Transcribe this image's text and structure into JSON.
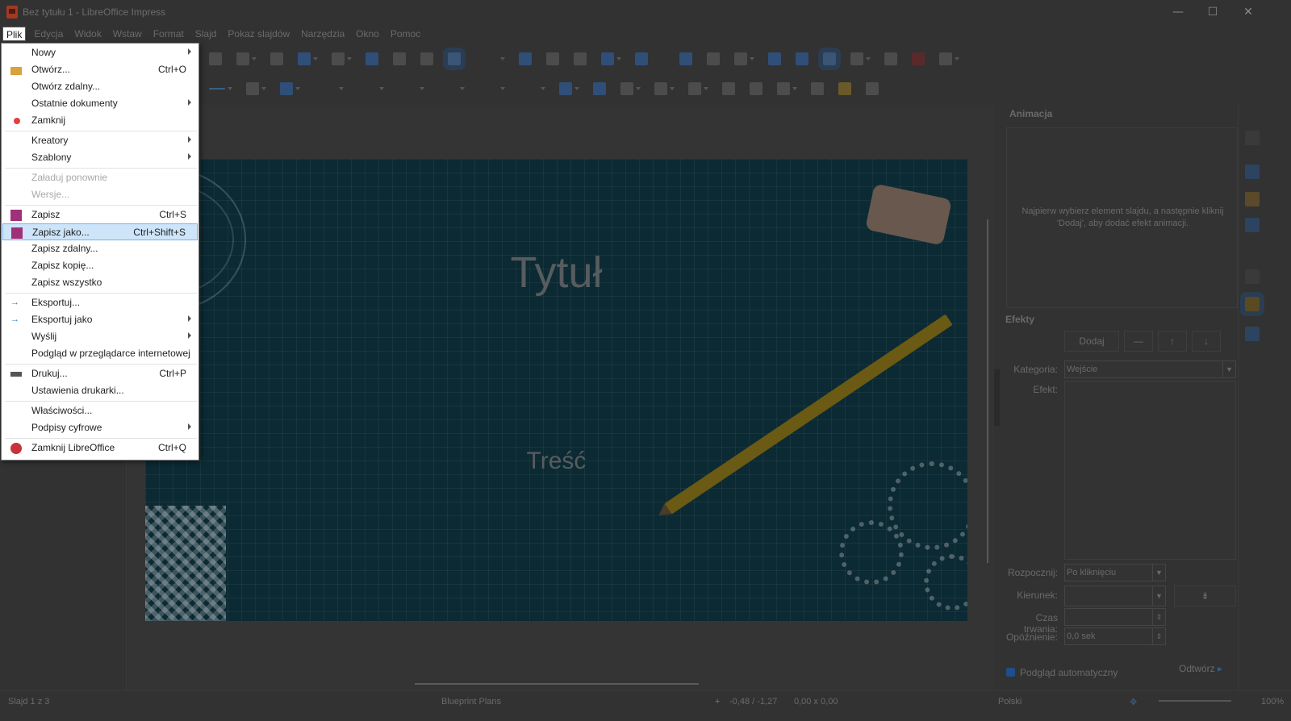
{
  "window": {
    "title": "Bez tytułu 1 - LibreOffice Impress",
    "minimize": "—",
    "maximize": "☐",
    "close": "✕"
  },
  "menubar": [
    "Plik",
    "Edycja",
    "Widok",
    "Wstaw",
    "Format",
    "Slajd",
    "Pokaz slajdów",
    "Narzędzia",
    "Okno",
    "Pomoc"
  ],
  "file_menu": {
    "items": [
      {
        "label": "Nowy",
        "submenu": true
      },
      {
        "label": "Otwórz...",
        "shortcut": "Ctrl+O",
        "icon": "folder-open-icon"
      },
      {
        "label": "Otwórz zdalny..."
      },
      {
        "label": "Ostatnie dokumenty",
        "submenu": true
      },
      {
        "label": "Zamknij",
        "icon": "close-document-icon"
      },
      {
        "label": "Kreatory",
        "submenu": true
      },
      {
        "label": "Szablony",
        "submenu": true
      },
      {
        "label": "Załaduj ponownie",
        "disabled": true
      },
      {
        "label": "Wersje...",
        "disabled": true
      },
      {
        "label": "Zapisz",
        "shortcut": "Ctrl+S",
        "icon": "save-icon"
      },
      {
        "label": "Zapisz jako...",
        "shortcut": "Ctrl+Shift+S",
        "icon": "save-as-icon",
        "highlighted": true
      },
      {
        "label": "Zapisz zdalny..."
      },
      {
        "label": "Zapisz kopię..."
      },
      {
        "label": "Zapisz wszystko"
      },
      {
        "label": "Eksportuj...",
        "icon": "export-icon"
      },
      {
        "label": "Eksportuj jako",
        "submenu": true,
        "icon": "export-as-icon"
      },
      {
        "label": "Wyślij",
        "submenu": true
      },
      {
        "label": "Podgląd w przeglądarce internetowej"
      },
      {
        "label": "Drukuj...",
        "shortcut": "Ctrl+P",
        "icon": "print-icon"
      },
      {
        "label": "Ustawienia drukarki..."
      },
      {
        "label": "Właściwości..."
      },
      {
        "label": "Podpisy cyfrowe",
        "submenu": true
      },
      {
        "label": "Zamknij LibreOffice",
        "shortcut": "Ctrl+Q",
        "icon": "exit-icon"
      }
    ]
  },
  "slide": {
    "title": "Tytuł",
    "content": "Treść"
  },
  "sidebar": {
    "animation_header": "Animacja",
    "animation_hint": "Najpierw wybierz element slajdu, a następnie kliknij 'Dodaj', aby dodać efekt animacji.",
    "effects_header": "Efekty",
    "add_button": "Dodaj",
    "category_label": "Kategoria:",
    "category_value": "Wejście",
    "effect_label": "Efekt:",
    "start_label": "Rozpocznij:",
    "start_value": "Po kliknięciu",
    "direction_label": "Kierunek:",
    "duration_label": "Czas trwania:",
    "delay_label": "Opóźnienie:",
    "delay_value": "0,0 sek",
    "autopreview_label": "Podgląd automatyczny",
    "play_button": "Odtwórz"
  },
  "statusbar": {
    "slide_info": "Slajd 1 z 3",
    "master": "Blueprint Plans",
    "position": "-0,48 / -1,27",
    "size": "0,00 x 0,00",
    "language": "Polski",
    "zoom": "100%"
  }
}
